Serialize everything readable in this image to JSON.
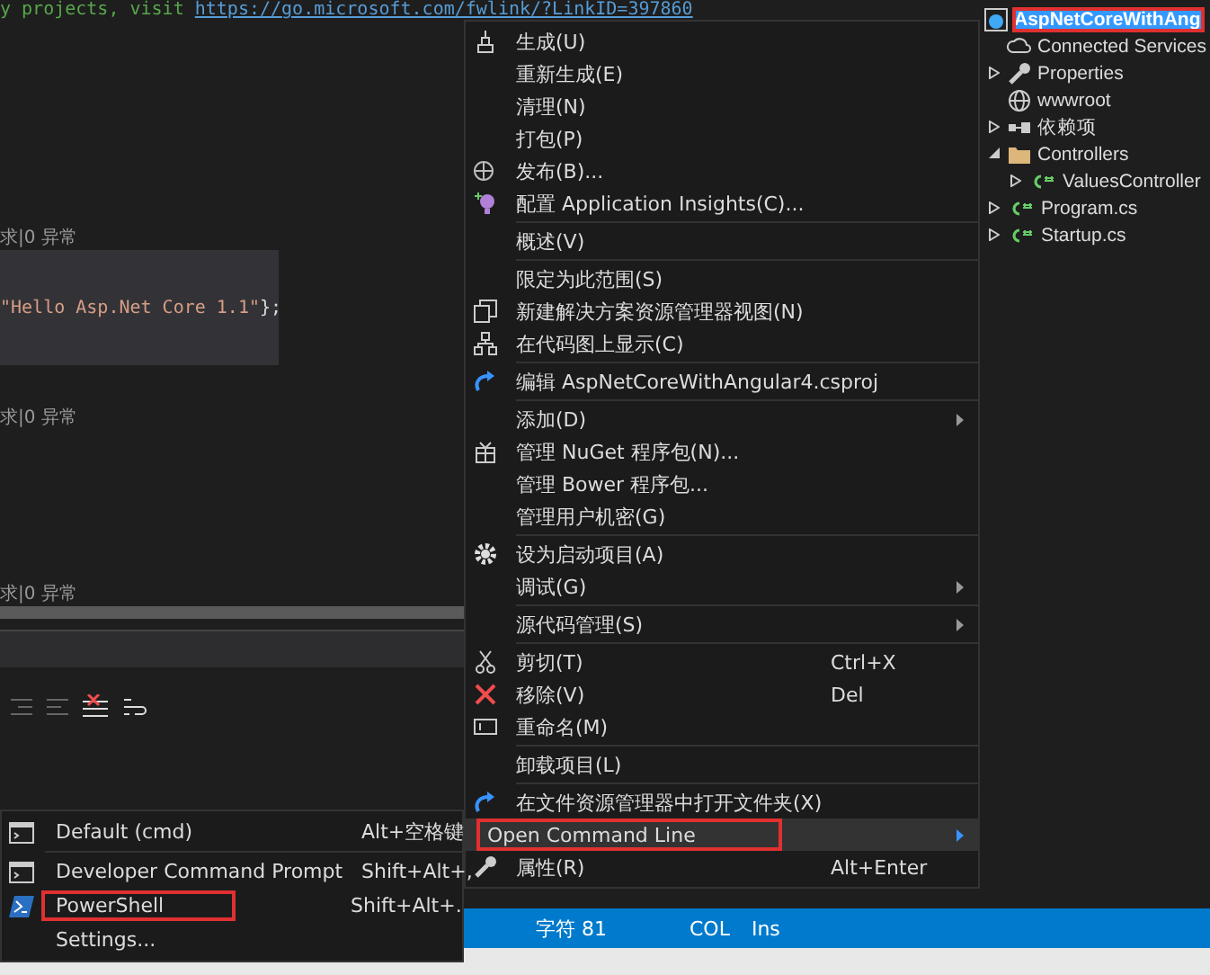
{
  "editor": {
    "comment": "y projects, visit ",
    "link": "https://go.microsoft.com/fwlink/?LinkID=397860",
    "codelens": [
      "求|0 异常",
      "求|0 异常",
      "求|0 异常"
    ],
    "code_string": "\"Hello Asp.Net Core 1.1\"",
    "code_end": " };"
  },
  "context_menu": {
    "items": [
      {
        "kind": "item",
        "label": "生成(U)",
        "submenu": false,
        "selected": false
      },
      {
        "kind": "item",
        "label": "重新生成(E)",
        "submenu": false,
        "selected": false
      },
      {
        "kind": "item",
        "label": "清理(N)",
        "submenu": false,
        "selected": false
      },
      {
        "kind": "item",
        "label": "打包(P)",
        "submenu": false,
        "selected": false
      },
      {
        "kind": "item",
        "label": "发布(B)...",
        "submenu": false,
        "selected": false
      },
      {
        "kind": "item",
        "label": "配置 Application Insights(C)...",
        "submenu": false,
        "selected": false
      },
      {
        "kind": "separator"
      },
      {
        "kind": "item",
        "label": "概述(V)",
        "submenu": false,
        "selected": false
      },
      {
        "kind": "separator"
      },
      {
        "kind": "item",
        "label": "限定为此范围(S)",
        "submenu": false,
        "selected": false
      },
      {
        "kind": "item",
        "label": "新建解决方案资源管理器视图(N)",
        "submenu": false,
        "selected": false
      },
      {
        "kind": "item",
        "label": "在代码图上显示(C)",
        "submenu": false,
        "selected": false
      },
      {
        "kind": "separator"
      },
      {
        "kind": "item",
        "label": "编辑 AspNetCoreWithAngular4.csproj",
        "submenu": false,
        "selected": false
      },
      {
        "kind": "separator"
      },
      {
        "kind": "item",
        "label": "添加(D)",
        "submenu": true,
        "selected": false
      },
      {
        "kind": "item",
        "label": "管理 NuGet 程序包(N)...",
        "submenu": false,
        "selected": false
      },
      {
        "kind": "item",
        "label": "管理 Bower 程序包...",
        "submenu": false,
        "selected": false
      },
      {
        "kind": "item",
        "label": "管理用户机密(G)",
        "submenu": false,
        "selected": false
      },
      {
        "kind": "separator"
      },
      {
        "kind": "item",
        "label": "设为启动项目(A)",
        "submenu": false,
        "selected": false
      },
      {
        "kind": "item",
        "label": "调试(G)",
        "submenu": true,
        "selected": false
      },
      {
        "kind": "separator"
      },
      {
        "kind": "item",
        "label": "源代码管理(S)",
        "submenu": true,
        "selected": false
      },
      {
        "kind": "separator"
      },
      {
        "kind": "item",
        "label": "剪切(T)",
        "shortcut": "Ctrl+X",
        "submenu": false,
        "selected": false
      },
      {
        "kind": "item",
        "label": "移除(V)",
        "shortcut": "Del",
        "submenu": false,
        "selected": false
      },
      {
        "kind": "item",
        "label": "重命名(M)",
        "submenu": false,
        "selected": false
      },
      {
        "kind": "separator"
      },
      {
        "kind": "item",
        "label": "卸载项目(L)",
        "submenu": false,
        "selected": false
      },
      {
        "kind": "separator"
      },
      {
        "kind": "item",
        "label": "在文件资源管理器中打开文件夹(X)",
        "submenu": false,
        "selected": false
      },
      {
        "kind": "item",
        "label": "Open Command Line",
        "submenu": true,
        "selected": true
      },
      {
        "kind": "item",
        "label": "属性(R)",
        "shortcut": "Alt+Enter",
        "submenu": false,
        "selected": false
      }
    ]
  },
  "submenu": {
    "items": [
      {
        "kind": "item",
        "label": "Default (cmd)",
        "shortcut": "Alt+空格键",
        "highlighted": false
      },
      {
        "kind": "separator"
      },
      {
        "kind": "item",
        "label": "Developer Command Prompt",
        "shortcut": "Shift+Alt+,",
        "highlighted": false
      },
      {
        "kind": "item",
        "label": "PowerShell",
        "shortcut": "Shift+Alt+.",
        "highlighted": true
      },
      {
        "kind": "item",
        "label": "Settings...",
        "highlighted": false
      }
    ]
  },
  "solution_explorer": {
    "root": {
      "label": "AspNetCoreWithAng",
      "selected": true,
      "children": [
        {
          "label": "Connected Services",
          "selected": false
        },
        {
          "label": "Properties",
          "expanded": false,
          "selected": false
        },
        {
          "label": "wwwroot",
          "selected": false
        },
        {
          "label": "依赖项",
          "expanded": false,
          "selected": false
        },
        {
          "label": "Controllers",
          "expanded": true,
          "selected": false,
          "children": [
            {
              "label": "ValuesController",
              "expanded": false,
              "selected": false
            }
          ]
        },
        {
          "label": "Program.cs",
          "expanded": false,
          "selected": false
        },
        {
          "label": "Startup.cs",
          "expanded": false,
          "selected": false
        }
      ]
    }
  },
  "status_bar": {
    "items": [
      "字符 81",
      "COL",
      "Ins"
    ]
  }
}
